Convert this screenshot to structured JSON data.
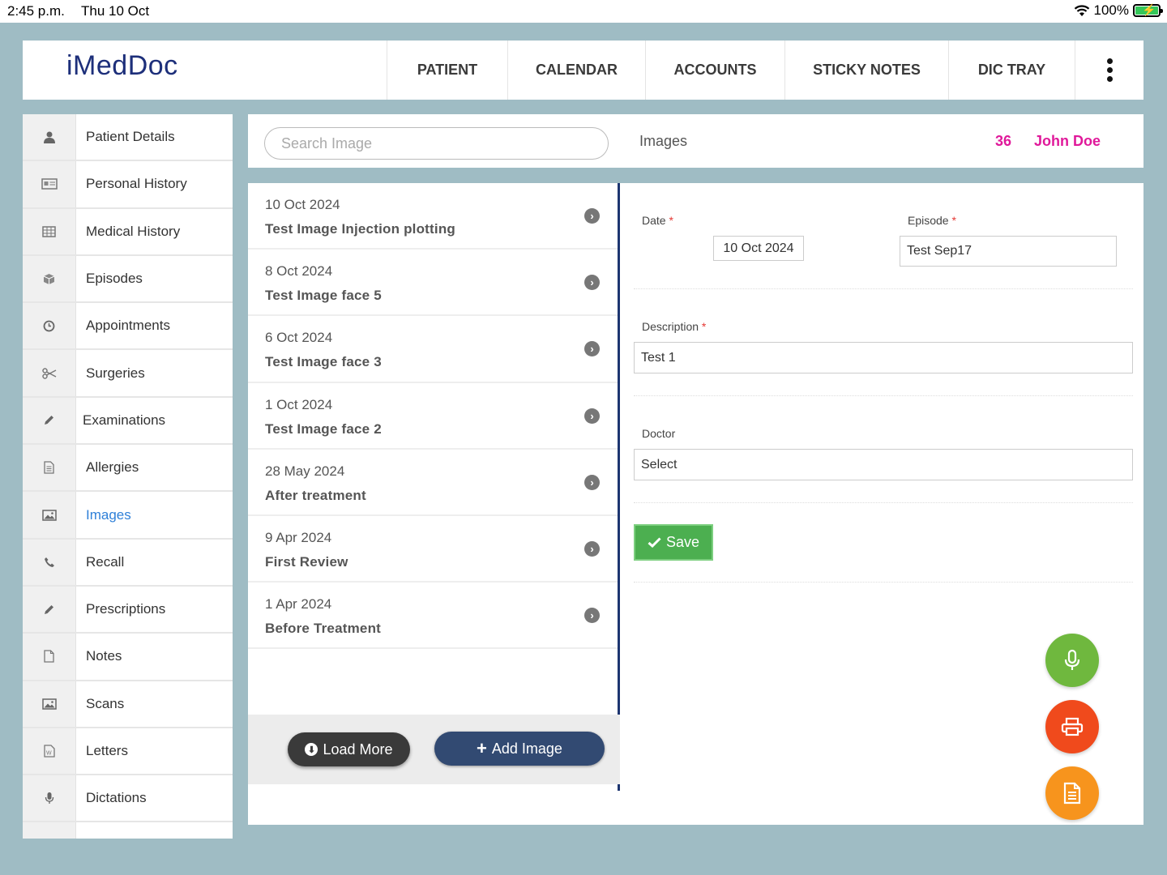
{
  "status_bar": {
    "time": "2:45 p.m.",
    "date": "Thu 10 Oct",
    "battery": "100%"
  },
  "header": {
    "logo": "iMedDoc",
    "nav": [
      {
        "label": "PATIENT"
      },
      {
        "label": "CALENDAR"
      },
      {
        "label": "ACCOUNTS"
      },
      {
        "label": "STICKY NOTES"
      },
      {
        "label": "DIC TRAY"
      }
    ]
  },
  "sidebar": {
    "items": [
      {
        "label": "Patient Details",
        "icon": "user-icon"
      },
      {
        "label": "Personal History",
        "icon": "id-card-icon"
      },
      {
        "label": "Medical History",
        "icon": "table-icon"
      },
      {
        "label": "Episodes",
        "icon": "cube-icon"
      },
      {
        "label": "Appointments",
        "icon": "clock-icon"
      },
      {
        "label": "Surgeries",
        "icon": "scissors-icon"
      },
      {
        "label": "Examinations",
        "icon": "pencil-icon"
      },
      {
        "label": "Allergies",
        "icon": "document-icon"
      },
      {
        "label": "Images",
        "icon": "image-icon",
        "active": true
      },
      {
        "label": "Recall",
        "icon": "phone-icon"
      },
      {
        "label": "Prescriptions",
        "icon": "pencil-icon"
      },
      {
        "label": "Notes",
        "icon": "file-icon"
      },
      {
        "label": "Scans",
        "icon": "image-icon"
      },
      {
        "label": "Letters",
        "icon": "word-file-icon"
      },
      {
        "label": "Dictations",
        "icon": "microphone-icon"
      }
    ],
    "active_color": "#2f80d8"
  },
  "top": {
    "search_placeholder": "Search Image",
    "section_title": "Images",
    "patient_id": "36",
    "patient_name": "John Doe",
    "patient_color": "#e0199a"
  },
  "images": {
    "items": [
      {
        "date": "10 Oct 2024",
        "title": "Test Image Injection plotting"
      },
      {
        "date": "8 Oct 2024",
        "title": "Test Image face 5"
      },
      {
        "date": "6 Oct 2024",
        "title": "Test Image face 3"
      },
      {
        "date": "1 Oct 2024",
        "title": "Test Image face 2"
      },
      {
        "date": "28 May 2024",
        "title": "After treatment"
      },
      {
        "date": "9 Apr 2024",
        "title": "First Review"
      },
      {
        "date": "1 Apr 2024",
        "title": "Before Treatment"
      }
    ],
    "load_more_label": "Load More",
    "add_image_label": "Add Image"
  },
  "form": {
    "date_label": "Date",
    "date_value": "10 Oct 2024",
    "episode_label": "Episode",
    "episode_value": "Test Sep17",
    "description_label": "Description",
    "description_value": "Test 1",
    "doctor_label": "Doctor",
    "doctor_value": "Select",
    "required_mark": "*",
    "save_label": "Save"
  },
  "fabs": [
    {
      "icon": "microphone-icon",
      "color": "#6fb83e"
    },
    {
      "icon": "printer-icon",
      "color": "#f04a1c"
    },
    {
      "icon": "document-icon",
      "color": "#f7941d"
    }
  ]
}
